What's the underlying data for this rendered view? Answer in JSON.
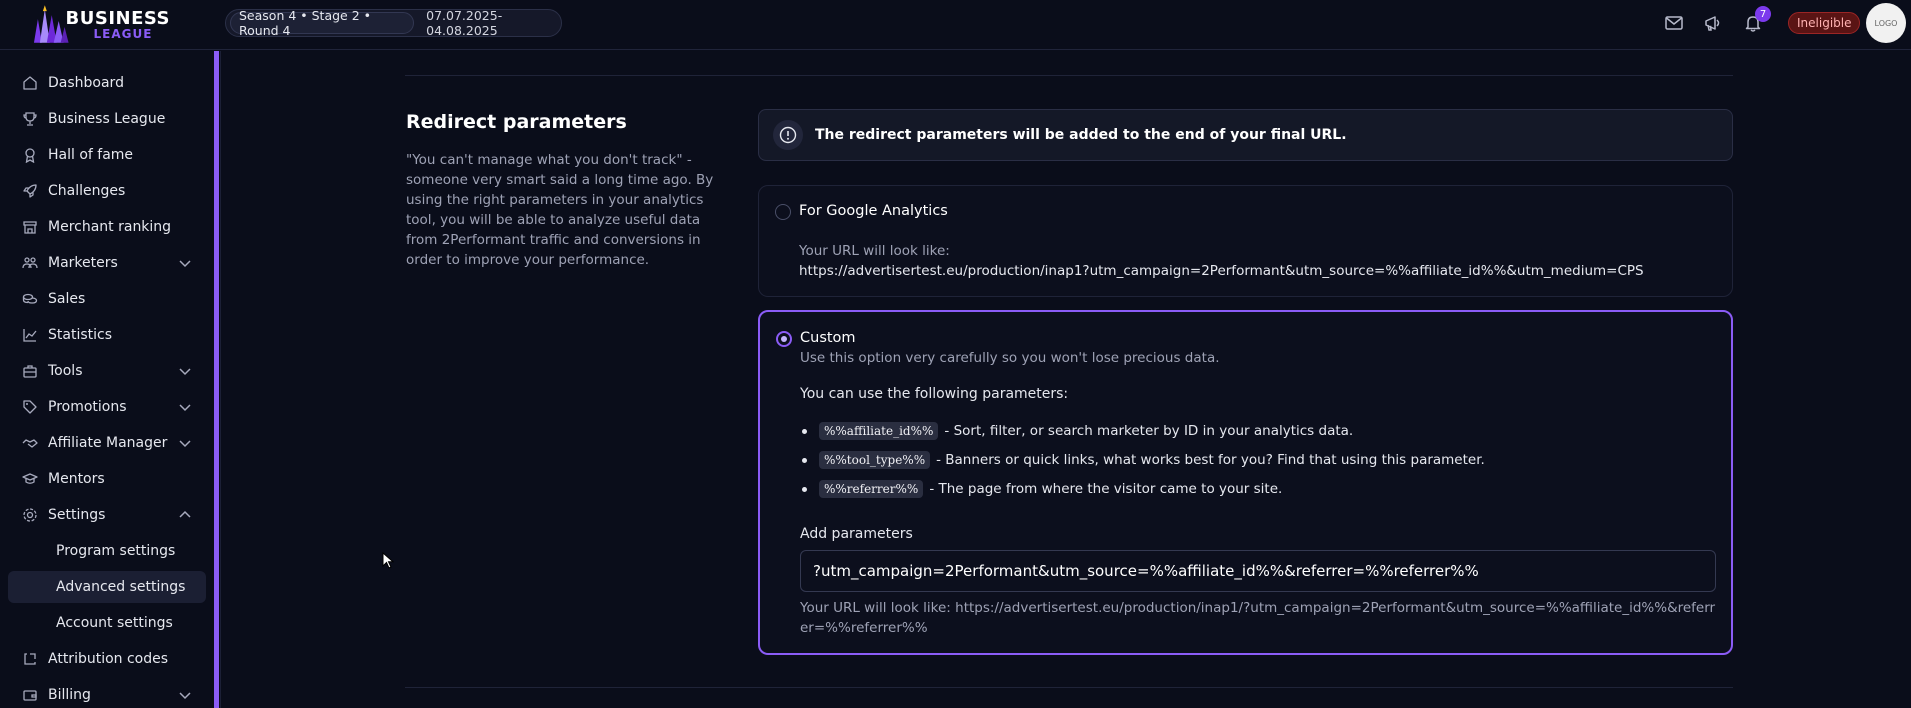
{
  "header": {
    "logo_line1": "BUSINESS",
    "logo_line2": "LEAGUE",
    "season": "Season 4 • Stage 2 • Round 4",
    "dates": "07.07.2025-04.08.2025",
    "notification_count": "7",
    "status_badge": "Ineligible",
    "avatar_text": "LOGO"
  },
  "sidebar": {
    "items": [
      {
        "label": "Dashboard",
        "icon": "home-icon"
      },
      {
        "label": "Business League",
        "icon": "trophy-icon"
      },
      {
        "label": "Hall of fame",
        "icon": "medal-icon"
      },
      {
        "label": "Challenges",
        "icon": "rocket-icon"
      },
      {
        "label": "Merchant ranking",
        "icon": "store-icon"
      },
      {
        "label": "Marketers",
        "icon": "users-icon",
        "expandable": true
      },
      {
        "label": "Sales",
        "icon": "coins-icon"
      },
      {
        "label": "Statistics",
        "icon": "chart-icon"
      },
      {
        "label": "Tools",
        "icon": "briefcase-icon",
        "expandable": true
      },
      {
        "label": "Promotions",
        "icon": "tag-icon",
        "expandable": true
      },
      {
        "label": "Affiliate Manager",
        "icon": "handshake-icon",
        "expandable": true
      },
      {
        "label": "Mentors",
        "icon": "graduation-icon"
      },
      {
        "label": "Settings",
        "icon": "gear-icon",
        "expanded": true
      },
      {
        "label": "Attribution codes",
        "icon": "code-icon"
      },
      {
        "label": "Billing",
        "icon": "wallet-icon",
        "expandable": true
      }
    ],
    "settings_sub": [
      {
        "label": "Program settings"
      },
      {
        "label": "Advanced settings",
        "active": true
      },
      {
        "label": "Account settings"
      }
    ]
  },
  "section": {
    "title": "Redirect parameters",
    "description": "\"You can't manage what you don't track\" - someone very smart said a long time ago. By using the right parameters in your analytics tool, you will be able to analyze useful data from 2Performant traffic and conversions in order to improve your performance.",
    "info": "The redirect parameters will be added to the end of your final URL."
  },
  "google_option": {
    "title": "For Google Analytics",
    "url_label": "Your URL will look like:",
    "url": "https://advertisertest.eu/production/inap1?utm_campaign=2Performant&utm_source=%%affiliate_id%%&utm_medium=CPS",
    "selected": false
  },
  "custom_option": {
    "title": "Custom",
    "subtitle": "Use this option very carefully so you won't lose precious data.",
    "params_heading": "You can use the following parameters:",
    "params": [
      {
        "code": "%%affiliate_id%%",
        "text": "- Sort, filter, or search marketer by ID in your analytics data."
      },
      {
        "code": "%%tool_type%%",
        "text": "- Banners or quick links, what works best for you? Find that using this parameter."
      },
      {
        "code": "%%referrer%%",
        "text": "- The page from where the visitor came to your site."
      }
    ],
    "add_label": "Add parameters",
    "input_value": "?utm_campaign=2Performant&utm_source=%%affiliate_id%%&referrer=%%referrer%%",
    "result_url": "Your URL will look like: https://advertisertest.eu/production/inap1/?utm_campaign=2Performant&utm_source=%%affiliate_id%%&referrer=%%referrer%%",
    "selected": true
  },
  "colors": {
    "accent": "#8b5cf6",
    "background": "#0a0d1a",
    "danger": "#9b2525"
  }
}
